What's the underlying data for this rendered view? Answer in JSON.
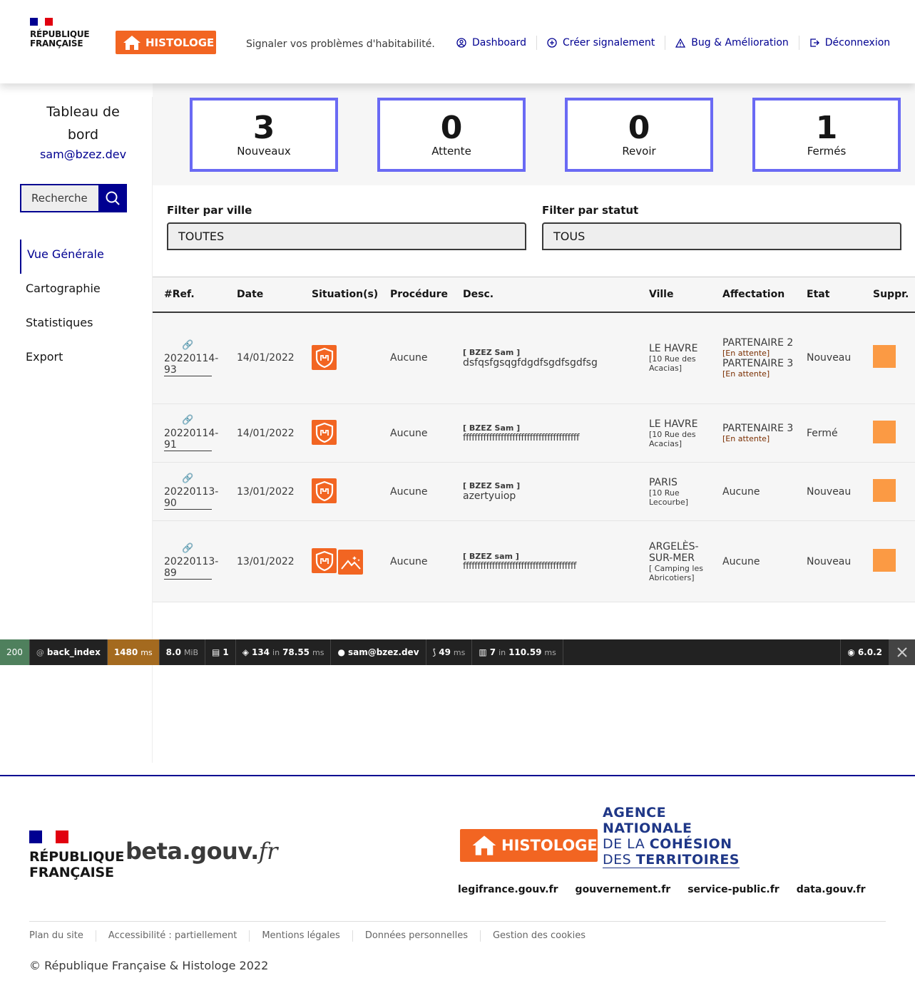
{
  "header": {
    "rf_line1": "RÉPUBLIQUE",
    "rf_line2": "FRANÇAISE",
    "logo_text": "HISTOLOGE",
    "tagline": "Signaler vos problèmes d'habitabilité.",
    "nav": [
      {
        "label": "Dashboard",
        "icon": "user-circle-icon"
      },
      {
        "label": "Créer signalement",
        "icon": "plus-circle-icon"
      },
      {
        "label": "Bug & Amélioration",
        "icon": "warning-icon"
      },
      {
        "label": "Déconnexion",
        "icon": "logout-icon"
      }
    ]
  },
  "sidebar": {
    "title": "Tableau de bord",
    "email": "sam@bzez.dev",
    "search_placeholder": "Recherche",
    "items": [
      {
        "label": "Vue Générale",
        "active": true
      },
      {
        "label": "Cartographie"
      },
      {
        "label": "Statistiques"
      },
      {
        "label": "Export"
      }
    ]
  },
  "stats": [
    {
      "count": "3",
      "label": "Nouveaux"
    },
    {
      "count": "0",
      "label": "Attente"
    },
    {
      "count": "0",
      "label": "Revoir"
    },
    {
      "count": "1",
      "label": "Fermés"
    }
  ],
  "filters": {
    "ville_label": "Filter par ville",
    "ville_value": "TOUTES",
    "statut_label": "Filter par statut",
    "statut_value": "TOUS"
  },
  "table": {
    "headers": [
      "#Ref.",
      "Date",
      "Situation(s)",
      "Procédure",
      "Desc.",
      "Ville",
      "Affectation",
      "Etat",
      "Suppr."
    ],
    "rows": [
      {
        "ref": "20220114-93",
        "date": "14/01/2022",
        "procedure": "Aucune",
        "author": "[ BZEZ Sam ]",
        "desc": "dsfqsfgsqgfdgdfsgdfsgdfsg",
        "ville": "LE HAVRE",
        "adresse": "[10 Rue des Acacias]",
        "affectations": [
          {
            "name": "PARTENAIRE 2",
            "status": "[En attente]"
          },
          {
            "name": "PARTENAIRE 3",
            "status": "[En attente]"
          }
        ],
        "etat": "Nouveau"
      },
      {
        "ref": "20220114-91",
        "date": "14/01/2022",
        "procedure": "Aucune",
        "author": "[ BZEZ Sam ]",
        "desc": "ffffffffffffffffffffffffffffffffffffffff",
        "ville": "LE HAVRE",
        "adresse": "[10 Rue des Acacias]",
        "affectations": [
          {
            "name": "PARTENAIRE 3",
            "status": "[En attente]"
          }
        ],
        "etat": "Fermé"
      },
      {
        "ref": "20220113-90",
        "date": "13/01/2022",
        "procedure": "Aucune",
        "author": "[ BZEZ Sam ]",
        "desc": "azertyuiop",
        "ville": "PARIS",
        "adresse": "[10 Rue Lecourbe]",
        "affectation_text": "Aucune",
        "etat": "Nouveau"
      },
      {
        "ref": "20220113-89",
        "date": "13/01/2022",
        "procedure": "Aucune",
        "author": "[ BZEZ sam ]",
        "desc": "fffffffffffffffffffffffffffffffffffffff",
        "ville": "ARGELÈS-SUR-MER",
        "adresse": "[ Camping les Abricotiers]",
        "affectation_text": "Aucune",
        "etat": "Nouveau"
      }
    ]
  },
  "debug": {
    "status": "200",
    "route": "back_index",
    "time": "1480",
    "time_unit": "ms",
    "memory": "8.0",
    "memory_unit": "MiB",
    "forms": "1",
    "db_count": "134",
    "db_time": "78.55",
    "user": "sam@bzez.dev",
    "twig": "49",
    "cache_count": "7",
    "cache_time": "110.59",
    "version": "6.0.2",
    "in_word": "in",
    "ms": "ms",
    "at": "@"
  },
  "footer": {
    "rf_line1": "RÉPUBLIQUE",
    "rf_line2": "FRANÇAISE",
    "beta_1": "beta",
    "beta_2": ".gouv.",
    "beta_3": "fr",
    "logo_text": "HISTOLOGE",
    "anct_1": "AGENCE",
    "anct_2": "NATIONALE",
    "anct_3a": "DE LA ",
    "anct_3b": "COHÉSION",
    "anct_4a": "DES ",
    "anct_4b": "TERRITOIRES",
    "external": [
      "legifrance.gouv.fr",
      "gouvernement.fr",
      "service-public.fr",
      "data.gouv.fr"
    ],
    "links": [
      "Plan du site",
      "Accessibilité : partiellement",
      "Mentions légales",
      "Données personnelles",
      "Gestion des cookies"
    ],
    "copyright": "© République Française & Histologe 2022"
  },
  "colors": {
    "primary": "#000091",
    "accent": "#f26522",
    "card_border": "#6a6af4",
    "delete": "#fb9a44"
  }
}
